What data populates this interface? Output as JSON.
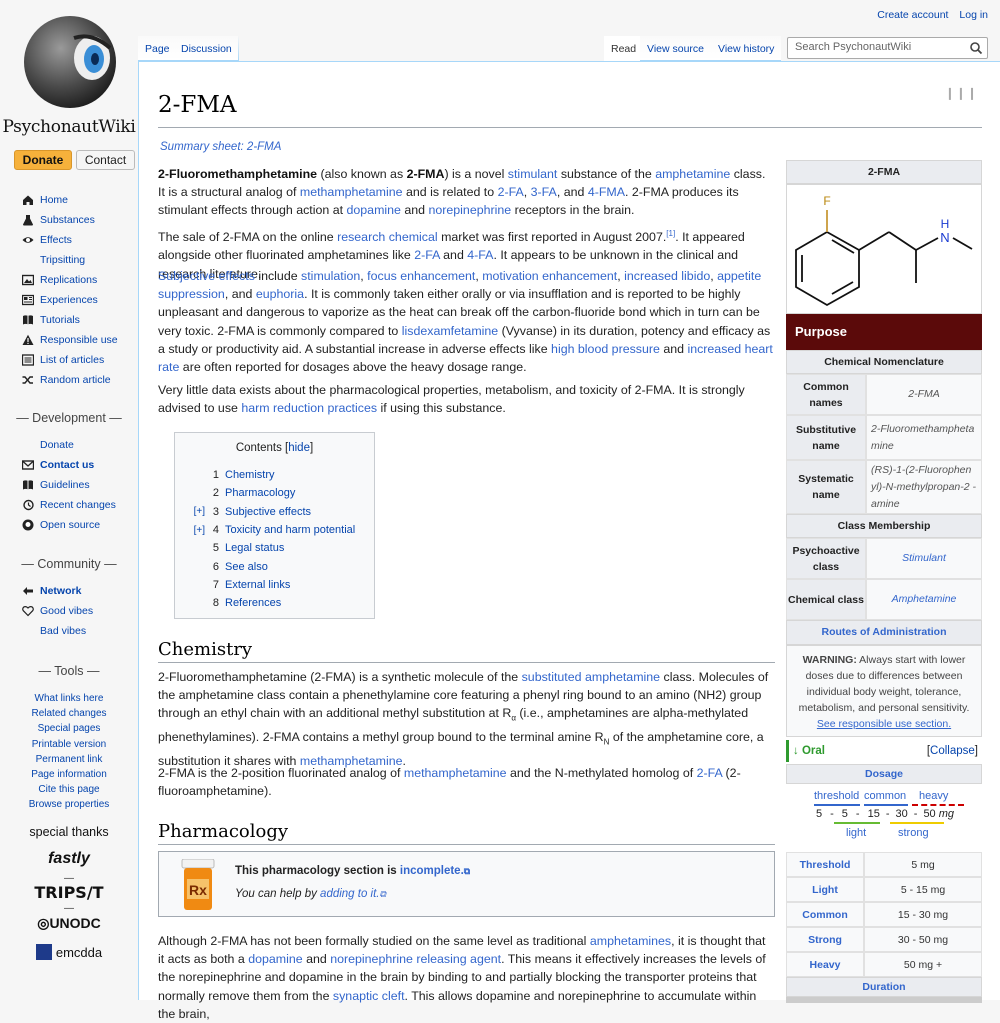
{
  "site": {
    "wordmark": "PsychonautWiki",
    "donate": "Donate",
    "contact": "Contact"
  },
  "nav": {
    "main": [
      {
        "icon": "home-icon",
        "label": "Home"
      },
      {
        "icon": "flask-icon",
        "label": "Substances"
      },
      {
        "icon": "eye-icon",
        "label": "Effects"
      },
      {
        "icon": "",
        "label": "Tripsitting"
      },
      {
        "icon": "image-icon",
        "label": "Replications"
      },
      {
        "icon": "newspaper-icon",
        "label": "Experiences"
      },
      {
        "icon": "book-icon",
        "label": "Tutorials"
      },
      {
        "icon": "warning-icon",
        "label": "Responsible use"
      },
      {
        "icon": "list-icon",
        "label": "List of articles"
      },
      {
        "icon": "shuffle-icon",
        "label": "Random article"
      }
    ],
    "development_head": "— Development —",
    "development": [
      {
        "icon": "",
        "label": "Donate",
        "bold": false
      },
      {
        "icon": "envelope-icon",
        "label": "Contact us",
        "bold": true
      },
      {
        "icon": "book-icon",
        "label": "Guidelines",
        "bold": false
      },
      {
        "icon": "history-icon",
        "label": "Recent changes",
        "bold": false
      },
      {
        "icon": "github-icon",
        "label": "Open source",
        "bold": false
      }
    ],
    "community_head": "— Community —",
    "community": [
      {
        "icon": "network-icon",
        "label": "Network",
        "bold": true
      },
      {
        "icon": "heart-icon",
        "label": "Good vibes",
        "bold": false
      },
      {
        "icon": "",
        "label": "Bad vibes",
        "bold": false
      }
    ],
    "tools_head": "— Tools —",
    "tools": [
      "What links here",
      "Related changes",
      "Special pages",
      "Printable version",
      "Permanent link",
      "Page information",
      "Cite this page",
      "Browse properties"
    ],
    "thanks": "special thanks",
    "sponsors": [
      "fastly",
      "TRIPS/T",
      "UNODC",
      "emcdda"
    ],
    "sep": "—"
  },
  "header": {
    "create_account": "Create account",
    "login": "Log in",
    "tabs_left": [
      "Page",
      "Discussion"
    ],
    "tabs_right": [
      "Read",
      "View source",
      "View history"
    ],
    "search_placeholder": "Search PsychonautWiki"
  },
  "article": {
    "title": "2-FMA",
    "summary": "Summary sheet: 2-FMA",
    "toc_title": "Contents",
    "toc_hide": "hide",
    "toc": [
      {
        "num": "1",
        "label": "Chemistry",
        "toggle": ""
      },
      {
        "num": "2",
        "label": "Pharmacology",
        "toggle": ""
      },
      {
        "num": "3",
        "label": "Subjective effects",
        "toggle": "[+]"
      },
      {
        "num": "4",
        "label": "Toxicity and harm potential",
        "toggle": "[+]"
      },
      {
        "num": "5",
        "label": "Legal status",
        "toggle": ""
      },
      {
        "num": "6",
        "label": "See also",
        "toggle": ""
      },
      {
        "num": "7",
        "label": "External links",
        "toggle": ""
      },
      {
        "num": "8",
        "label": "References",
        "toggle": ""
      }
    ],
    "chemistry_heading": "Chemistry",
    "pharmacology_heading": "Pharmacology",
    "incomplete_line1": "This pharmacology section is ",
    "incomplete_link": "incomplete.",
    "incomplete_line2": "You can help by ",
    "incomplete_link2": "adding to it."
  },
  "infobox": {
    "title": "2-FMA",
    "purpose": "Purpose",
    "nomenclature_head": "Chemical Nomenclature",
    "nomenclature": [
      {
        "label": "Common names",
        "value": "2-FMA"
      },
      {
        "label": "Substitutive name",
        "value": "2-Fluoromethampheta mine"
      },
      {
        "label": "Systematic name",
        "value": "(RS)-1-(2-Fluorophen yl)-N-methylpropan-2 -amine"
      }
    ],
    "class_head": "Class Membership",
    "classes": [
      {
        "label": "Psychoactive class",
        "value": "Stimulant"
      },
      {
        "label": "Chemical class",
        "value": "Amphetamine"
      }
    ],
    "roa_head": "Routes of Administration",
    "warning_bold": "WARNING:",
    "warning_text": " Always start with lower doses due to differences between individual body weight, tolerance, metabolism, and personal sensitivity.",
    "warning_link": "See responsible use section.",
    "route": "Oral",
    "collapse": "Collapse",
    "dosage_head": "Dosage",
    "scale_top": [
      "threshold",
      "common",
      "heavy"
    ],
    "scale_nums": [
      "5",
      "5",
      "15",
      "30",
      "50"
    ],
    "scale_unit": "mg",
    "scale_bottom": [
      "light",
      "strong"
    ],
    "doses": [
      {
        "label": "Threshold",
        "value": "5 mg"
      },
      {
        "label": "Light",
        "value": "5 - 15 mg"
      },
      {
        "label": "Common",
        "value": "15 - 30 mg"
      },
      {
        "label": "Strong",
        "value": "30 - 50 mg"
      },
      {
        "label": "Heavy",
        "value": "50 mg +"
      }
    ],
    "duration_head": "Duration",
    "colors": {
      "purpose_bg": "#5b0a0a",
      "threshold": "#3366cc",
      "heavy": "#cc0000",
      "light": "#66bb33",
      "strong": "#eecc00"
    }
  },
  "colors": {
    "link": "#0645ad",
    "accent": "#f6b13b"
  }
}
